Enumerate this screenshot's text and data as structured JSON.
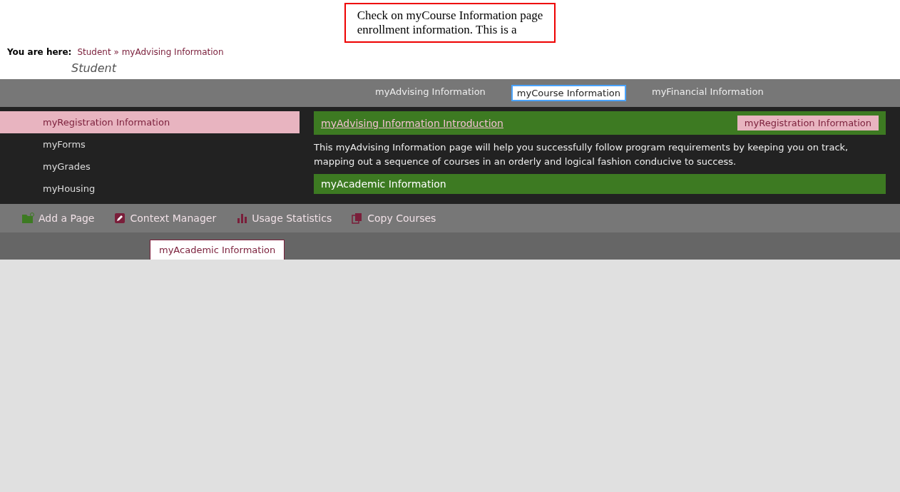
{
  "callout": {
    "lines": [
      "Check on myCourse Information page",
      "enrollment information. This is a"
    ]
  },
  "breadcrumb": {
    "label": "You are here:",
    "path": "Student » myAdvising Information"
  },
  "page_title": "Student",
  "nav": {
    "items": [
      {
        "label": "myAdvising Information",
        "selected": false
      },
      {
        "label": "myCourse Information",
        "selected": true
      },
      {
        "label": "myFinancial Information",
        "selected": false
      }
    ]
  },
  "sidebar": {
    "items": [
      {
        "label": "myRegistration Information",
        "selected": true
      },
      {
        "label": "myForms",
        "selected": false
      },
      {
        "label": "myGrades",
        "selected": false
      },
      {
        "label": "myHousing",
        "selected": false
      }
    ]
  },
  "main": {
    "link": "myAdvising Information Introduction",
    "tag": "myRegistration Information",
    "intro": "This myAdvising Information page will help you successfully follow program requirements by keeping you on track, mapping out a sequence of courses in an orderly and logical fashion conducive to success.",
    "section_heading": "myAcademic Information"
  },
  "admin_toolbar": {
    "items": [
      {
        "label": "Add a Page",
        "kind": "add"
      },
      {
        "label": "Context Manager",
        "kind": "edit"
      },
      {
        "label": "Usage Statistics",
        "kind": "stats"
      },
      {
        "label": "Copy Courses",
        "kind": "copy"
      }
    ]
  },
  "footer_tab": "myAcademic Information"
}
